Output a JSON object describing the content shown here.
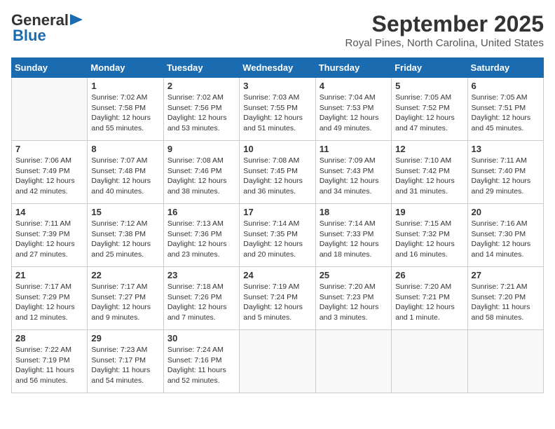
{
  "header": {
    "logo_general": "General",
    "logo_blue": "Blue",
    "month_title": "September 2025",
    "location": "Royal Pines, North Carolina, United States"
  },
  "days_of_week": [
    "Sunday",
    "Monday",
    "Tuesday",
    "Wednesday",
    "Thursday",
    "Friday",
    "Saturday"
  ],
  "weeks": [
    [
      {
        "day": "",
        "info": ""
      },
      {
        "day": "1",
        "info": "Sunrise: 7:02 AM\nSunset: 7:58 PM\nDaylight: 12 hours\nand 55 minutes."
      },
      {
        "day": "2",
        "info": "Sunrise: 7:02 AM\nSunset: 7:56 PM\nDaylight: 12 hours\nand 53 minutes."
      },
      {
        "day": "3",
        "info": "Sunrise: 7:03 AM\nSunset: 7:55 PM\nDaylight: 12 hours\nand 51 minutes."
      },
      {
        "day": "4",
        "info": "Sunrise: 7:04 AM\nSunset: 7:53 PM\nDaylight: 12 hours\nand 49 minutes."
      },
      {
        "day": "5",
        "info": "Sunrise: 7:05 AM\nSunset: 7:52 PM\nDaylight: 12 hours\nand 47 minutes."
      },
      {
        "day": "6",
        "info": "Sunrise: 7:05 AM\nSunset: 7:51 PM\nDaylight: 12 hours\nand 45 minutes."
      }
    ],
    [
      {
        "day": "7",
        "info": "Sunrise: 7:06 AM\nSunset: 7:49 PM\nDaylight: 12 hours\nand 42 minutes."
      },
      {
        "day": "8",
        "info": "Sunrise: 7:07 AM\nSunset: 7:48 PM\nDaylight: 12 hours\nand 40 minutes."
      },
      {
        "day": "9",
        "info": "Sunrise: 7:08 AM\nSunset: 7:46 PM\nDaylight: 12 hours\nand 38 minutes."
      },
      {
        "day": "10",
        "info": "Sunrise: 7:08 AM\nSunset: 7:45 PM\nDaylight: 12 hours\nand 36 minutes."
      },
      {
        "day": "11",
        "info": "Sunrise: 7:09 AM\nSunset: 7:43 PM\nDaylight: 12 hours\nand 34 minutes."
      },
      {
        "day": "12",
        "info": "Sunrise: 7:10 AM\nSunset: 7:42 PM\nDaylight: 12 hours\nand 31 minutes."
      },
      {
        "day": "13",
        "info": "Sunrise: 7:11 AM\nSunset: 7:40 PM\nDaylight: 12 hours\nand 29 minutes."
      }
    ],
    [
      {
        "day": "14",
        "info": "Sunrise: 7:11 AM\nSunset: 7:39 PM\nDaylight: 12 hours\nand 27 minutes."
      },
      {
        "day": "15",
        "info": "Sunrise: 7:12 AM\nSunset: 7:38 PM\nDaylight: 12 hours\nand 25 minutes."
      },
      {
        "day": "16",
        "info": "Sunrise: 7:13 AM\nSunset: 7:36 PM\nDaylight: 12 hours\nand 23 minutes."
      },
      {
        "day": "17",
        "info": "Sunrise: 7:14 AM\nSunset: 7:35 PM\nDaylight: 12 hours\nand 20 minutes."
      },
      {
        "day": "18",
        "info": "Sunrise: 7:14 AM\nSunset: 7:33 PM\nDaylight: 12 hours\nand 18 minutes."
      },
      {
        "day": "19",
        "info": "Sunrise: 7:15 AM\nSunset: 7:32 PM\nDaylight: 12 hours\nand 16 minutes."
      },
      {
        "day": "20",
        "info": "Sunrise: 7:16 AM\nSunset: 7:30 PM\nDaylight: 12 hours\nand 14 minutes."
      }
    ],
    [
      {
        "day": "21",
        "info": "Sunrise: 7:17 AM\nSunset: 7:29 PM\nDaylight: 12 hours\nand 12 minutes."
      },
      {
        "day": "22",
        "info": "Sunrise: 7:17 AM\nSunset: 7:27 PM\nDaylight: 12 hours\nand 9 minutes."
      },
      {
        "day": "23",
        "info": "Sunrise: 7:18 AM\nSunset: 7:26 PM\nDaylight: 12 hours\nand 7 minutes."
      },
      {
        "day": "24",
        "info": "Sunrise: 7:19 AM\nSunset: 7:24 PM\nDaylight: 12 hours\nand 5 minutes."
      },
      {
        "day": "25",
        "info": "Sunrise: 7:20 AM\nSunset: 7:23 PM\nDaylight: 12 hours\nand 3 minutes."
      },
      {
        "day": "26",
        "info": "Sunrise: 7:20 AM\nSunset: 7:21 PM\nDaylight: 12 hours\nand 1 minute."
      },
      {
        "day": "27",
        "info": "Sunrise: 7:21 AM\nSunset: 7:20 PM\nDaylight: 11 hours\nand 58 minutes."
      }
    ],
    [
      {
        "day": "28",
        "info": "Sunrise: 7:22 AM\nSunset: 7:19 PM\nDaylight: 11 hours\nand 56 minutes."
      },
      {
        "day": "29",
        "info": "Sunrise: 7:23 AM\nSunset: 7:17 PM\nDaylight: 11 hours\nand 54 minutes."
      },
      {
        "day": "30",
        "info": "Sunrise: 7:24 AM\nSunset: 7:16 PM\nDaylight: 11 hours\nand 52 minutes."
      },
      {
        "day": "",
        "info": ""
      },
      {
        "day": "",
        "info": ""
      },
      {
        "day": "",
        "info": ""
      },
      {
        "day": "",
        "info": ""
      }
    ]
  ]
}
